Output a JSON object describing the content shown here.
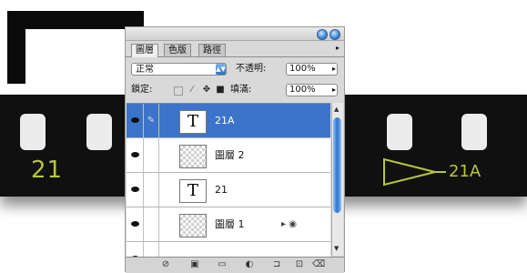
{
  "canvas": {
    "frame_labels": [
      "21",
      "21A"
    ]
  },
  "panel": {
    "tabs": [
      {
        "label": "圖層",
        "active": true
      },
      {
        "label": "色版",
        "active": false
      },
      {
        "label": "路徑",
        "active": false
      }
    ],
    "blend_mode": "正常",
    "opacity_label": "不透明:",
    "opacity_value": "100%",
    "lock_label": "鎖定:",
    "fill_label": "填滿:",
    "fill_value": "100%",
    "layers": [
      {
        "name": "21A",
        "thumb": "T",
        "selected": true
      },
      {
        "name": "圖層 2",
        "thumb": "",
        "selected": false
      },
      {
        "name": "21",
        "thumb": "T",
        "selected": false
      },
      {
        "name": "圖層 1",
        "thumb": "",
        "selected": false
      }
    ],
    "colors": {
      "selection": "#3c74c9",
      "accent_text": "#b7c63a"
    }
  }
}
